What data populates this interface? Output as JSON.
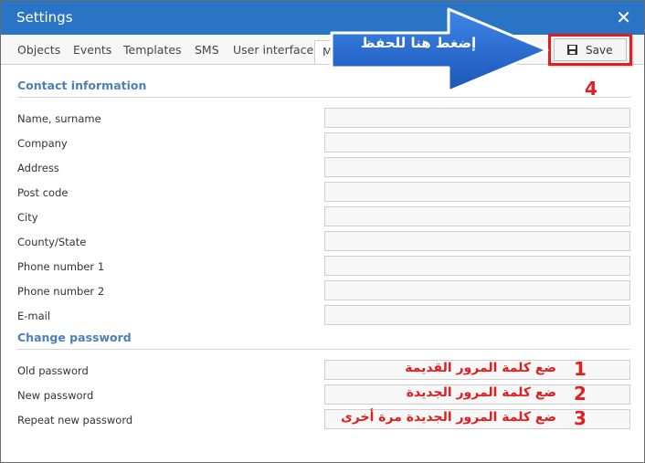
{
  "window": {
    "title": "Settings",
    "close_label": "✕"
  },
  "tabs": [
    {
      "label": "Objects"
    },
    {
      "label": "Events"
    },
    {
      "label": "Templates"
    },
    {
      "label": "SMS"
    },
    {
      "label": "User interface"
    },
    {
      "label": "M"
    }
  ],
  "toolbar": {
    "save_label": "Save"
  },
  "contact": {
    "title": "Contact information",
    "fields": [
      {
        "label": "Name, surname",
        "value": ""
      },
      {
        "label": "Company",
        "value": ""
      },
      {
        "label": "Address",
        "value": ""
      },
      {
        "label": "Post code",
        "value": ""
      },
      {
        "label": "City",
        "value": ""
      },
      {
        "label": "County/State",
        "value": ""
      },
      {
        "label": "Phone number 1",
        "value": ""
      },
      {
        "label": "Phone number 2",
        "value": ""
      },
      {
        "label": "E-mail",
        "value": ""
      }
    ]
  },
  "password": {
    "title": "Change password",
    "fields": [
      {
        "label": "Old password",
        "value": ""
      },
      {
        "label": "New password",
        "value": ""
      },
      {
        "label": "Repeat new password",
        "value": ""
      }
    ]
  },
  "annotations": {
    "arrow_text": "إضغط هنا للحفظ",
    "save_number": "4",
    "steps": [
      {
        "number": "1",
        "text": "ضع كلمة المرور القديمة"
      },
      {
        "number": "2",
        "text": "ضع كلمة المرور الجديدة"
      },
      {
        "number": "3",
        "text": "ضع كلمة المرور الجديدة مرة أخرى"
      }
    ]
  },
  "colors": {
    "title_bar": "#2a74c6",
    "section_title": "#4d7fb8",
    "annotation_red": "#e01f1f",
    "arrow_blue": "#1f63c9"
  },
  "icons": {
    "save": "floppy-disk-icon",
    "close": "close-icon"
  }
}
